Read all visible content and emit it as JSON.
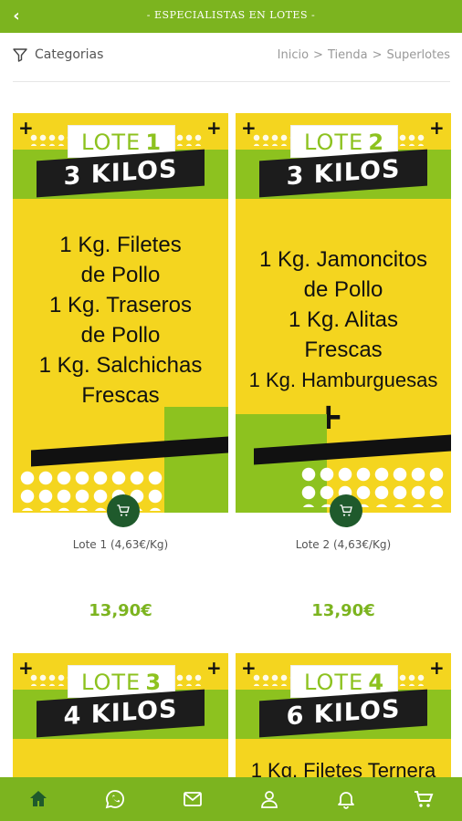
{
  "header": {
    "back_label": "‹",
    "title": "- ESPECIALISTAS EN LOTES -"
  },
  "filter": {
    "label": "Categorias"
  },
  "breadcrumb": {
    "items": [
      "Inicio",
      "Tienda",
      "Superlotes"
    ],
    "separator": ">"
  },
  "products": [
    {
      "lote_word": "LOTE",
      "lote_number": "1",
      "kilos": "3 KILOS",
      "lines": [
        "1 Kg. Filetes",
        "de Pollo",
        "1 Kg. Traseros",
        "de Pollo",
        "1 Kg. Salchichas",
        "Frescas"
      ],
      "name": "Lote 1 (4,63€/Kg)",
      "price": "13,90€"
    },
    {
      "lote_word": "LOTE",
      "lote_number": "2",
      "kilos": "3 KILOS",
      "lines": [
        "1 Kg. Jamoncitos",
        "de Pollo",
        "1 Kg. Alitas",
        "Frescas",
        "1 Kg. Hamburguesas"
      ],
      "name": "Lote 2 (4,63€/Kg)",
      "price": "13,90€"
    },
    {
      "lote_word": "LOTE",
      "lote_number": "3",
      "kilos": "4 KILOS",
      "lines": []
    },
    {
      "lote_word": "LOTE",
      "lote_number": "4",
      "kilos": "6 KILOS",
      "lines": [
        "1 Kg. Filetes Ternera"
      ]
    }
  ],
  "tabs": [
    {
      "icon": "home-icon",
      "active": true
    },
    {
      "icon": "whatsapp-icon"
    },
    {
      "icon": "mail-icon"
    },
    {
      "icon": "user-icon"
    },
    {
      "icon": "bell-icon"
    },
    {
      "icon": "cart-icon"
    }
  ],
  "colors": {
    "brand_green": "#7cb41f",
    "poster_yellow": "#f4d51f",
    "poster_green": "#8dc21f",
    "cart_button": "#1f5a2c",
    "active_tab_icon": "#1f5a2c"
  }
}
